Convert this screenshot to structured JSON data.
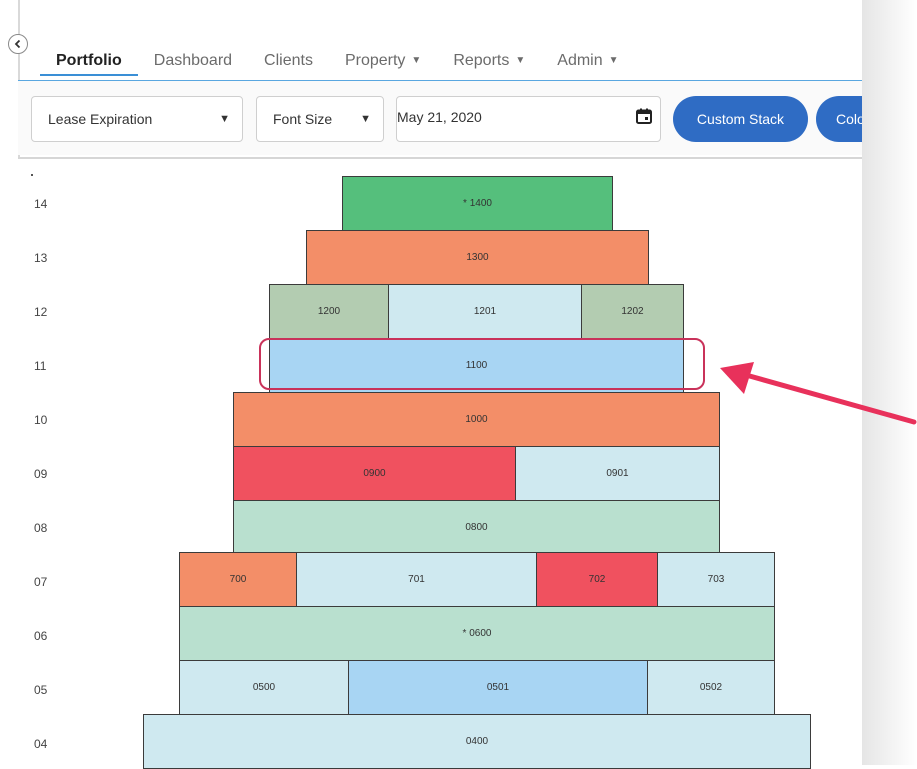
{
  "nav": {
    "tabs": [
      {
        "label": "Portfolio"
      },
      {
        "label": "Dashboard"
      },
      {
        "label": "Clients"
      },
      {
        "label": "Property"
      },
      {
        "label": "Reports"
      },
      {
        "label": "Admin"
      }
    ]
  },
  "toolbar": {
    "report_select": "Lease Expiration",
    "font_size_select": "Font Size",
    "date_value": "May 21, 2020",
    "custom_stack_label": "Custom Stack",
    "color_button_label": "Colo"
  },
  "stack": {
    "floors": [
      "14",
      "13",
      "12",
      "11",
      "10",
      "09",
      "08",
      "07",
      "06",
      "05",
      "04"
    ],
    "units": {
      "u1400": "* 1400",
      "u1300": "1300",
      "u1200": "1200",
      "u1201": "1201",
      "u1202": "1202",
      "u1100": "1100",
      "u1000": "1000",
      "u0900": "0900",
      "u0901": "0901",
      "u0800": "0800",
      "u700": "700",
      "u701": "701",
      "u702": "702",
      "u703": "703",
      "u0600": "* 0600",
      "u0500": "0500",
      "u0501": "0501",
      "u0502": "0502",
      "u0400": "0400"
    }
  },
  "colors": {
    "green": "#55bf7c",
    "orange": "#f38e68",
    "sage": "#b3ccb1",
    "light_blue": "#cfe9f0",
    "sky_blue": "#a8d5f3",
    "red": "#f0515f",
    "mint": "#b9e0cf",
    "button_blue": "#2f6cc4",
    "highlight_red": "#c9325a",
    "arrow_pink": "#e8315b"
  }
}
